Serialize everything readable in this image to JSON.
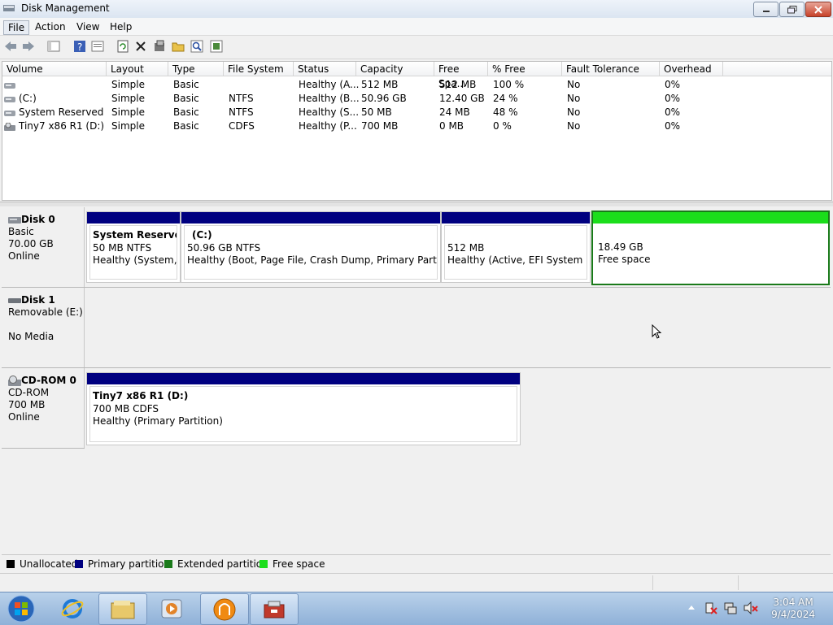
{
  "window": {
    "title": "Disk Management"
  },
  "menu": [
    "File",
    "Action",
    "View",
    "Help"
  ],
  "toolbar": {
    "icons": [
      "back-icon",
      "forward-icon",
      "show-hide-icon",
      "help-icon",
      "properties-icon",
      "refresh-icon",
      "delete-icon",
      "settings-icon",
      "open-icon",
      "search-icon",
      "export-icon"
    ]
  },
  "volume_table": {
    "columns": [
      "Volume",
      "Layout",
      "Type",
      "File System",
      "Status",
      "Capacity",
      "Free Spa...",
      "% Free",
      "Fault Tolerance",
      "Overhead"
    ],
    "rows": [
      [
        "",
        "Simple",
        "Basic",
        "",
        "Healthy (A...",
        "512 MB",
        "512 MB",
        "100 %",
        "No",
        "0%"
      ],
      [
        "(C:)",
        "Simple",
        "Basic",
        "NTFS",
        "Healthy (B...",
        "50.96 GB",
        "12.40 GB",
        "24 %",
        "No",
        "0%"
      ],
      [
        "System Reserved",
        "Simple",
        "Basic",
        "NTFS",
        "Healthy (S...",
        "50 MB",
        "24 MB",
        "48 %",
        "No",
        "0%"
      ],
      [
        "Tiny7 x86 R1 (D:)",
        "Simple",
        "Basic",
        "CDFS",
        "Healthy (P...",
        "700 MB",
        "0 MB",
        "0 %",
        "No",
        "0%"
      ]
    ]
  },
  "disks": [
    {
      "name": "Disk 0",
      "type": "Basic",
      "size": "70.00 GB",
      "status": "Online",
      "partitions": [
        {
          "title": "System Reserved",
          "size": "50 MB NTFS",
          "status": "Healthy (System, P"
        },
        {
          "title": "(C:)",
          "size": "50.96 GB NTFS",
          "status": "Healthy (Boot, Page File, Crash Dump, Primary Partition)"
        },
        {
          "title": "",
          "size": "512 MB",
          "status": "Healthy (Active, EFI System Part"
        },
        {
          "title": "",
          "size": "18.49 GB",
          "status": "Free space"
        }
      ]
    },
    {
      "name": "Disk 1",
      "type": "Removable (E:)",
      "size": "",
      "status": "No Media",
      "partitions": []
    },
    {
      "name": "CD-ROM 0",
      "type": "CD-ROM",
      "size": "700 MB",
      "status": "Online",
      "partitions": [
        {
          "title": "Tiny7 x86 R1  (D:)",
          "size": "700 MB CDFS",
          "status": "Healthy (Primary Partition)"
        }
      ]
    }
  ],
  "legend": [
    {
      "label": "Unallocated",
      "color": "#000000"
    },
    {
      "label": "Primary partition",
      "color": "#000080"
    },
    {
      "label": "Extended partition",
      "color": "#1a7a1a"
    },
    {
      "label": "Free space",
      "color": "#1bde1b"
    }
  ],
  "taskbar": {
    "apps": [
      "start-button",
      "internet-explorer-icon",
      "file-explorer-icon",
      "media-player-icon",
      "app-icon",
      "computer-management-icon"
    ],
    "clock": {
      "time": "3:04 AM",
      "date": "9/4/2024"
    }
  }
}
